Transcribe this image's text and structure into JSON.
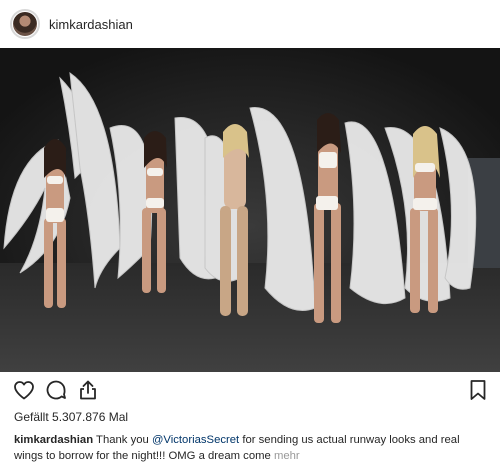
{
  "header": {
    "username": "kimkardashian"
  },
  "post": {
    "image_icon": "photo-of-five-women-with-angel-wings"
  },
  "actions": {
    "like_icon": "heart-icon",
    "comment_icon": "comment-icon",
    "share_icon": "share-icon",
    "save_icon": "bookmark-icon"
  },
  "likes": {
    "text": "Gefällt 5.307.876 Mal"
  },
  "caption": {
    "username": "kimkardashian",
    "text_before": " Thank you ",
    "mention": "@VictoriasSecret",
    "text_after": " for sending us actual runway looks and real wings to borrow for the night!!! OMG a dream come ",
    "more_label": "mehr"
  },
  "colors": {
    "text": "#262626",
    "mention": "#003569",
    "muted": "#999999",
    "background": "#ffffff"
  }
}
